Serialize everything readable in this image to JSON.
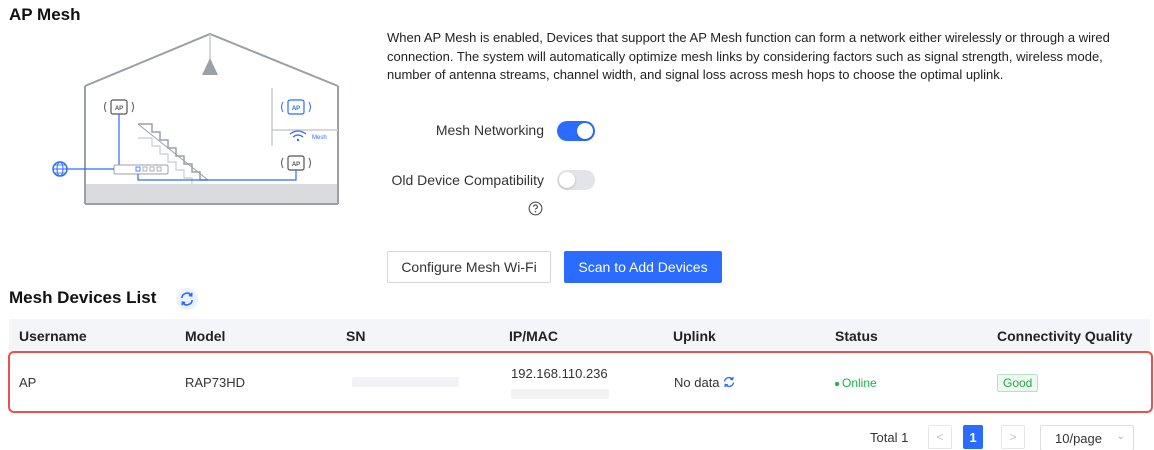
{
  "section": {
    "title": "AP Mesh",
    "description": "When AP Mesh is enabled, Devices that support the AP Mesh function can form a network either wirelessly or through a wired connection. The system will automatically optimize mesh links by considering factors such as signal strength, wireless mode, number of antenna streams, channel width, and signal loss across mesh hops to choose the optimal uplink."
  },
  "illustration": {
    "ap_label": "AP",
    "mesh_label": "Mesh"
  },
  "settings": {
    "mesh_networking": {
      "label": "Mesh Networking",
      "enabled": true
    },
    "old_device_compat": {
      "label": "Old Device Compatibility",
      "enabled": false
    }
  },
  "buttons": {
    "configure": "Configure Mesh Wi-Fi",
    "scan": "Scan to Add Devices"
  },
  "list": {
    "title": "Mesh Devices List",
    "columns": [
      "Username",
      "Model",
      "SN",
      "IP/MAC",
      "Uplink",
      "Status",
      "Connectivity Quality"
    ],
    "rows": [
      {
        "username": "AP",
        "model": "RAP73HD",
        "ip": "192.168.110.236",
        "uplink": "No data",
        "status": "Online",
        "quality": "Good"
      }
    ]
  },
  "pagination": {
    "total": "Total 1",
    "current_page": "1",
    "page_size": "10/page",
    "prev": "<",
    "next": ">"
  },
  "colors": {
    "accent": "#2b6bff",
    "online": "#1ab048",
    "highlight_border": "#e8514f"
  }
}
